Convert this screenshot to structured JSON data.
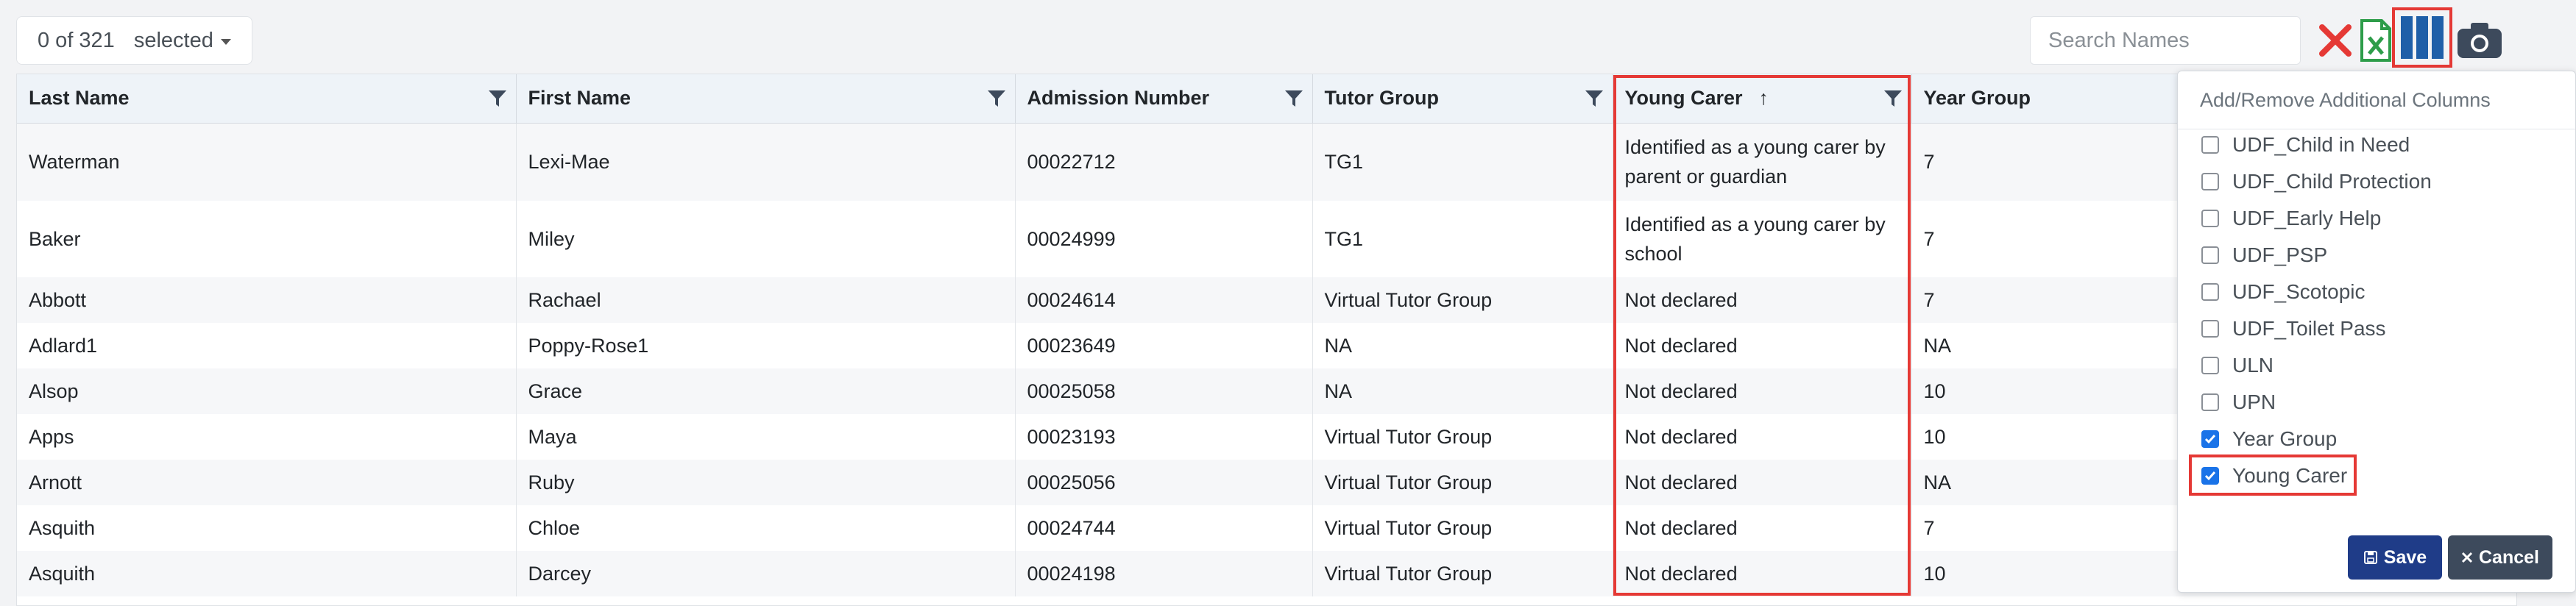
{
  "toolbar": {
    "selected_count": "0 of 321",
    "selected_label": "selected",
    "search_placeholder": "Search Names"
  },
  "table": {
    "columns": [
      "Last Name",
      "First Name",
      "Admission Number",
      "Tutor Group",
      "Young Carer",
      "Year Group"
    ],
    "sort_indicator": "↑",
    "rows": [
      [
        "Waterman",
        "Lexi-Mae",
        "00022712",
        "TG1",
        [
          "Identified as a young carer by",
          "parent or guardian"
        ],
        "7"
      ],
      [
        "Baker",
        "Miley",
        "00024999",
        "TG1",
        [
          "Identified as a young carer by",
          "school"
        ],
        "7"
      ],
      [
        "Abbott",
        "Rachael",
        "00024614",
        "Virtual Tutor Group",
        "Not declared",
        "7"
      ],
      [
        "Adlard1",
        "Poppy-Rose1",
        "00023649",
        "NA",
        "Not declared",
        "NA"
      ],
      [
        "Alsop",
        "Grace",
        "00025058",
        "NA",
        "Not declared",
        "10"
      ],
      [
        "Apps",
        "Maya",
        "00023193",
        "Virtual Tutor Group",
        "Not declared",
        "10"
      ],
      [
        "Arnott",
        "Ruby",
        "00025056",
        "Virtual Tutor Group",
        "Not declared",
        "NA"
      ],
      [
        "Asquith",
        "Chloe",
        "00024744",
        "Virtual Tutor Group",
        "Not declared",
        "7"
      ],
      [
        "Asquith",
        "Darcey",
        "00024198",
        "Virtual Tutor Group",
        "Not declared",
        "10"
      ]
    ]
  },
  "column_panel": {
    "title": "Add/Remove Additional Columns",
    "options": [
      {
        "label": "UDF_Child in Need",
        "checked": false
      },
      {
        "label": "UDF_Child Protection",
        "checked": false
      },
      {
        "label": "UDF_Early Help",
        "checked": false
      },
      {
        "label": "UDF_PSP",
        "checked": false
      },
      {
        "label": "UDF_Scotopic",
        "checked": false
      },
      {
        "label": "UDF_Toilet Pass",
        "checked": false
      },
      {
        "label": "ULN",
        "checked": false
      },
      {
        "label": "UPN",
        "checked": false
      },
      {
        "label": "Year Group",
        "checked": true
      },
      {
        "label": "Young Carer",
        "checked": true
      }
    ],
    "save_label": "Save",
    "cancel_label": "Cancel"
  },
  "colors": {
    "highlight": "#e53935",
    "clear_icon": "#e53935",
    "excel_icon": "#2e9d4a",
    "columns_icon": "#1f5fa8",
    "camera_icon": "#3d4a5c",
    "save_button": "#1f3c88",
    "cancel_button": "#3d4a5c"
  },
  "icons": [
    "clear-filter-icon",
    "excel-export-icon",
    "columns-icon",
    "camera-icon",
    "filter-funnel-icon",
    "sort-up-arrow-icon",
    "save-disk-icon",
    "cancel-x-icon"
  ]
}
